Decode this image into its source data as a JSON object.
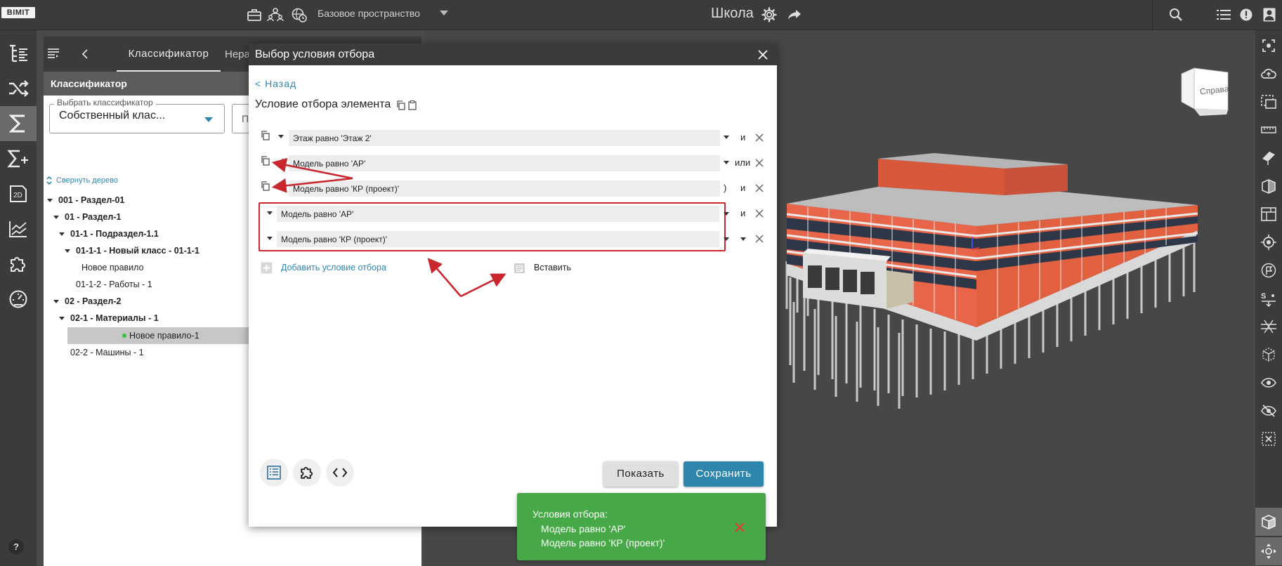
{
  "topbar": {
    "logo": "BIMIT",
    "space": "Базовое пространство",
    "project": "Школа"
  },
  "panel": {
    "tab_classifier": "Классификатор",
    "tab_second": "Нера",
    "header": "Классификатор",
    "select_label": "Выбрать классификатор",
    "select_value": "Собственный клас...",
    "second_select_value": "П",
    "collapse_tree": "Свернуть дерево",
    "tree": [
      {
        "label": "001 - Раздел-01",
        "bold": true
      },
      {
        "label": "01 - Раздел-1",
        "bold": true
      },
      {
        "label": "01-1 - Подраздел-1.1",
        "bold": true
      },
      {
        "label": "01-1-1 - Новый класс - 01-1-1",
        "bold": true
      },
      {
        "label": "Новое правило",
        "bold": false
      },
      {
        "label": "01-1-2 - Работы - 1",
        "bold": false
      },
      {
        "label": "02 - Раздел-2",
        "bold": true
      },
      {
        "label": "02-1 - Материалы - 1",
        "bold": true
      },
      {
        "label": "Новое правило-1",
        "bold": false
      },
      {
        "label": "02-2 - Машины - 1",
        "bold": false
      }
    ]
  },
  "dialog": {
    "title": "Выбор условия отбора",
    "back": "< Назад",
    "condition_title": "Условие отбора элемента",
    "conditions": [
      {
        "prefix": "",
        "text": "Этаж равно 'Этаж 2'",
        "suffix": "",
        "op": "и"
      },
      {
        "prefix": "(",
        "text": "Модель равно 'АР'",
        "suffix": "",
        "op": "или"
      },
      {
        "prefix": "",
        "text": "Модель равно 'КР (проект)'",
        "suffix": ")",
        "op": "и"
      }
    ],
    "group_conditions": [
      {
        "text": "Модель равно 'АР'",
        "op": "и"
      },
      {
        "text": "Модель равно 'КР (проект)'",
        "op": ""
      }
    ],
    "add_condition": "Добавить условие отбора",
    "paste": "Вставить",
    "show_button": "Показать",
    "save_button": "Сохранить"
  },
  "toast": {
    "title": "Условия отбора:",
    "line1": "Модель равно 'АР'",
    "line2": "Модель равно 'КР (проект)'"
  },
  "viewport": {
    "viewcube_label": "Справа"
  },
  "colors": {
    "accent": "#2f86ad",
    "dark_bar": "#3b3b3b",
    "toast_green": "#47a847",
    "highlight_red": "#c9262d",
    "facade_orange": "#e8654a"
  }
}
